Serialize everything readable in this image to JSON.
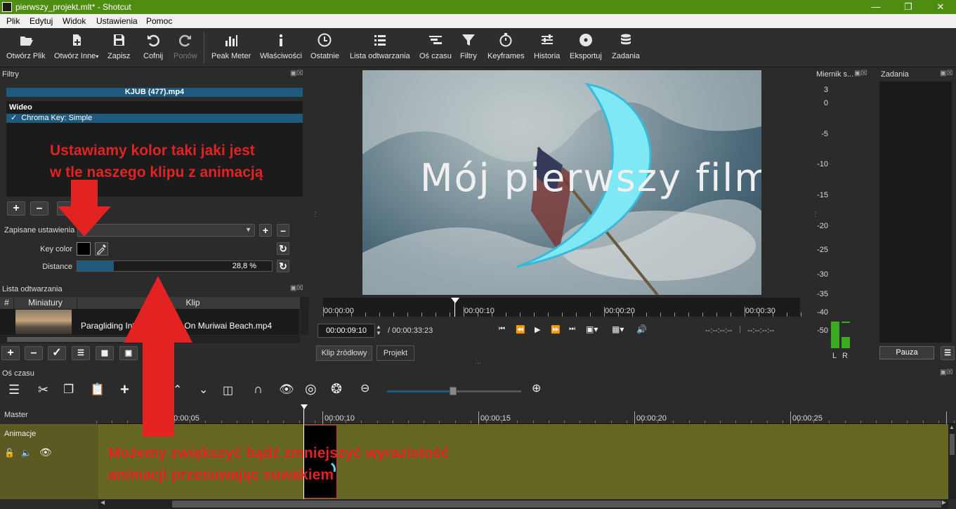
{
  "window": {
    "title": "pierwszy_projekt.mlt* - Shotcut"
  },
  "menu": [
    "Plik",
    "Edytuj",
    "Widok",
    "Ustawienia",
    "Pomoc"
  ],
  "toolbar": {
    "open_file": "Otwórz Plik",
    "open_other": "Otwórz Inne",
    "save": "Zapisz",
    "undo": "Cofnij",
    "redo": "Ponów",
    "peak_meter": "Peak Meter",
    "properties": "Właściwości",
    "recent": "Ostatnie",
    "playlist": "Lista odtwarzania",
    "timeline": "Oś czasu",
    "filters": "Filtry",
    "keyframes": "Keyframes",
    "history": "Historia",
    "export": "Eksportuj",
    "jobs": "Zadania"
  },
  "filters_panel": {
    "title": "Filtry",
    "clip_name": "KJUB (477).mp4",
    "category": "Wideo",
    "filter_item": "Chroma Key: Simple",
    "filter_checked": "✓",
    "preset_label": "Zapisane ustawienia",
    "key_color_label": "Key color",
    "key_color": "#000000",
    "distance_label": "Distance",
    "distance_value": "28,8 %",
    "distance_fraction": 0.288
  },
  "playlist_panel": {
    "title": "Lista odtwarzania",
    "col_num": "#",
    "col_thumb": "Miniatury",
    "col_clip": "Klip",
    "item": "Paragliding Into the Sunset On Muriwai Beach.mp4"
  },
  "viewer": {
    "overlay_text": "Mój pierwszy film",
    "ruler_labels": [
      "00:00:00",
      "00:00:10",
      "00:00:20",
      "00:00:30"
    ],
    "current_time": "00:00:09:10",
    "total_time": "/ 00:00:33:23",
    "in_point": "--:--:--:--",
    "out_point": "--:--:--:--",
    "tab_source": "Klip źródłowy",
    "tab_project": "Projekt"
  },
  "meter_panel": {
    "title": "Miernik s...",
    "scale": [
      "3",
      "0",
      "-5",
      "-10",
      "-15",
      "-20",
      "-25",
      "-30",
      "-35",
      "-40",
      "-50"
    ],
    "left_label": "L",
    "right_label": "R"
  },
  "jobs_panel": {
    "title": "Zadania",
    "pause": "Pauza"
  },
  "timeline_panel": {
    "title": "Oś czasu",
    "master": "Master",
    "track_name": "Animacje",
    "ruler_labels": [
      "00:00:05",
      "00:00:10",
      "00:00:15",
      "00:00:20",
      "00:00:25"
    ],
    "zoom_fraction": 0.49
  },
  "annotations": {
    "top_line1": "Ustawiamy kolor taki jaki jest",
    "top_line2": "w tle naszego klipu z animacją",
    "bottom_line1": "Możemy zwiększyć bądź zmniejszyć wyrazistość",
    "bottom_line2": "animacji przesuwając suwakiem"
  },
  "colors": {
    "titlebar": "#4f8d12",
    "selection": "#1e5a7e",
    "annotation": "#e32222",
    "track": "#666625",
    "meter": "#3aaa20"
  }
}
